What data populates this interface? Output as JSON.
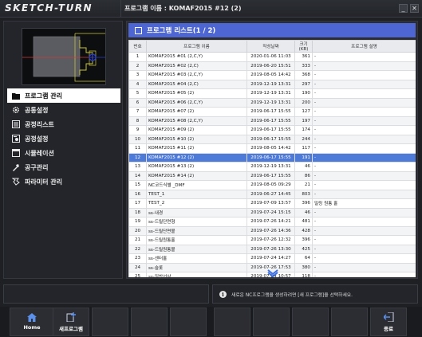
{
  "window": {
    "logo": "SKETCH-TURN",
    "title": "프로그램 이름 : KOMAF2015 #12 (2)",
    "minimize": "_",
    "close": "✕"
  },
  "sidebar": {
    "items": [
      {
        "label": "프로그램 관리",
        "icon": "folder-icon",
        "active": true
      },
      {
        "label": "공통설정",
        "icon": "gear-icon",
        "active": false
      },
      {
        "label": "공정리스트",
        "icon": "list-icon",
        "active": false
      },
      {
        "label": "공정설정",
        "icon": "process-settings-icon",
        "active": false
      },
      {
        "label": "시뮬레이션",
        "icon": "simulation-icon",
        "active": false
      },
      {
        "label": "공구관리",
        "icon": "tool-icon",
        "active": false
      },
      {
        "label": "파라미터 관리",
        "icon": "parameter-icon",
        "active": false
      }
    ]
  },
  "list": {
    "title": "프로그램 리스트(1 / 2)",
    "columns": [
      "번호",
      "프로그램 이름",
      "작성날짜",
      "크기(KB)",
      "프로그램 설명"
    ],
    "selected_row": "12",
    "rows": [
      {
        "no": "1",
        "name": "KOMAF2015 #01 (2,C,Y)",
        "date": "2020-01-06 11:03",
        "size": "361",
        "desc": "-"
      },
      {
        "no": "2",
        "name": "KOMAF2015 #02 (2,C)",
        "date": "2019-06-20 15:51",
        "size": "333",
        "desc": "-"
      },
      {
        "no": "3",
        "name": "KOMAF2015 #03 (2,C,Y)",
        "date": "2019-08-05 14:42",
        "date_": "",
        "size": "368",
        "desc": "-"
      },
      {
        "no": "4",
        "name": "KOMAF2015 #04 (2,C)",
        "date": "2019-12-19 13:31",
        "size": "297",
        "desc": "-"
      },
      {
        "no": "5",
        "name": "KOMAF2015 #05 (2)",
        "date": "2019-12-19 13:31",
        "size": "190",
        "desc": "-"
      },
      {
        "no": "6",
        "name": "KOMAF2015 #06 (2,C,Y)",
        "date": "2019-12-19 13:31",
        "size": "200",
        "desc": "-"
      },
      {
        "no": "7",
        "name": "KOMAF2015 #07 (2)",
        "date": "2019-06-17 15:55",
        "size": "127",
        "desc": "-"
      },
      {
        "no": "8",
        "name": "KOMAF2015 #08 (2,C,Y)",
        "date": "2019-06-17 15:55",
        "size": "197",
        "desc": "-"
      },
      {
        "no": "9",
        "name": "KOMAF2015 #09 (2)",
        "date": "2019-06-17 15:55",
        "size": "174",
        "desc": "-"
      },
      {
        "no": "10",
        "name": "KOMAF2015 #10 (2)",
        "date": "2019-06-17 15:55",
        "size": "244",
        "desc": "-"
      },
      {
        "no": "11",
        "name": "KOMAF2015 #11 (2)",
        "date": "2019-08-05 14:42",
        "size": "117",
        "desc": "-"
      },
      {
        "no": "12",
        "name": "KOMAF2015 #12 (2)",
        "date": "2019-06-17 15:55",
        "size": "191",
        "desc": "-"
      },
      {
        "no": "13",
        "name": "KOMAF2015 #13 (2)",
        "date": "2019-12-19 13:31",
        "size": "46",
        "desc": "-"
      },
      {
        "no": "14",
        "name": "KOMAF2015 #14 (2)",
        "date": "2019-06-17 15:55",
        "size": "86",
        "desc": "-"
      },
      {
        "no": "15",
        "name": "NC코드식별 _DMF",
        "date": "2019-08-05 09:29",
        "size": "21",
        "desc": "-"
      },
      {
        "no": "16",
        "name": "TEST_1",
        "date": "2019-06-27 14:45",
        "size": "803",
        "desc": "-"
      },
      {
        "no": "17",
        "name": "TEST_2",
        "date": "2019-07-09 13:57",
        "size": "396",
        "desc": "밀링 원통 홀"
      },
      {
        "no": "18",
        "name": "ss-내경",
        "date": "2019-07-24 15:15",
        "size": "46",
        "desc": "-"
      },
      {
        "no": "19",
        "name": "ss-드릴단면형",
        "date": "2019-07-26 14:21",
        "size": "481",
        "desc": "-"
      },
      {
        "no": "20",
        "name": "ss-드릴단면볼",
        "date": "2019-07-26 14:36",
        "size": "428",
        "desc": "-"
      },
      {
        "no": "21",
        "name": "ss-드릴원통홀",
        "date": "2019-07-26 12:32",
        "size": "396",
        "desc": "-"
      },
      {
        "no": "22",
        "name": "ss-드릴원통볼",
        "date": "2019-07-26 13:30",
        "size": "425",
        "desc": "-"
      },
      {
        "no": "23",
        "name": "ss-센터홀",
        "date": "2019-07-24 14:27",
        "size": "64",
        "desc": "-"
      },
      {
        "no": "24",
        "name": "ss-슬롯",
        "date": "2019-07-26 17:53",
        "size": "380",
        "desc": "-"
      },
      {
        "no": "25",
        "name": "ss-일반선삭",
        "date": "2019-07-24 10:57",
        "size": "118",
        "desc": "-"
      }
    ]
  },
  "message": {
    "info_icon": "i",
    "text": "새로운 NC프로그램을 생성하려면 [새 프로그램]을 선택하세요."
  },
  "bottom": {
    "home": "Home",
    "new_program": "새프로그램",
    "exit": "종료"
  },
  "colors": {
    "accent": "#4d66d1",
    "selected_row": "#4f7bd8",
    "active_menu": "#ffffff",
    "toolpath_yellow": "#c8c23a",
    "toolpath_blue": "#2a3fd6"
  }
}
